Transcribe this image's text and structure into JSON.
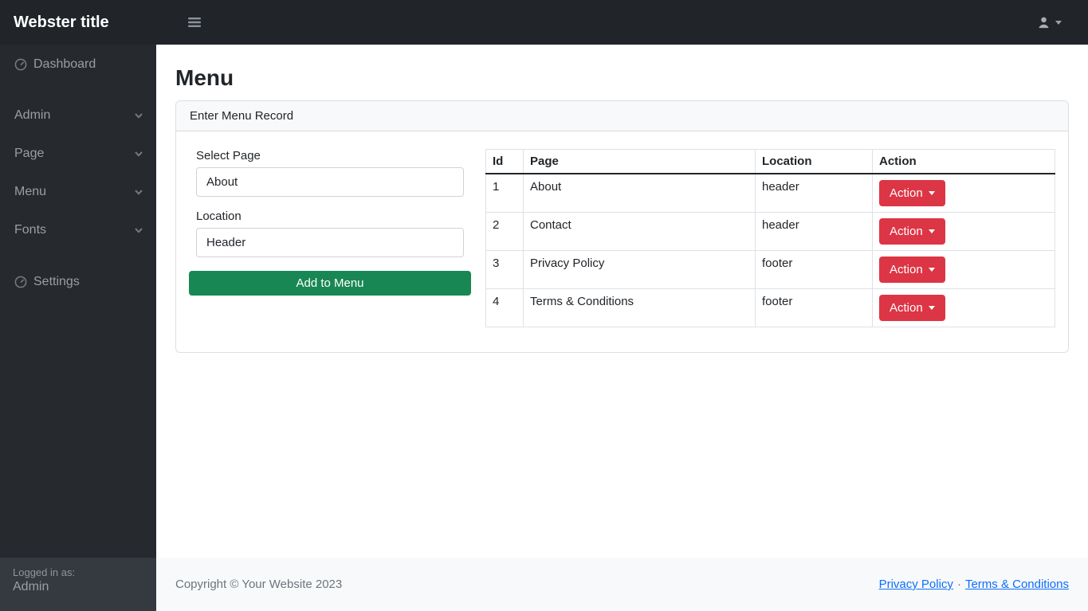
{
  "navbar": {
    "brand": "Webster title"
  },
  "sidebar": {
    "items": [
      {
        "label": "Dashboard",
        "icon": "gauge-icon",
        "type": "link"
      },
      {
        "label": "Admin",
        "icon": "chevron-down-icon",
        "type": "collapse"
      },
      {
        "label": "Page",
        "icon": "chevron-down-icon",
        "type": "collapse"
      },
      {
        "label": "Menu",
        "icon": "chevron-down-icon",
        "type": "collapse"
      },
      {
        "label": "Fonts",
        "icon": "chevron-down-icon",
        "type": "collapse"
      },
      {
        "label": "Settings",
        "icon": "gauge-icon",
        "type": "link"
      }
    ],
    "footer": {
      "label": "Logged in as:",
      "user": "Admin"
    }
  },
  "page": {
    "title": "Menu"
  },
  "card": {
    "header": "Enter Menu Record",
    "form": {
      "select_page_label": "Select Page",
      "select_page_value": "About",
      "location_label": "Location",
      "location_value": "Header",
      "submit_label": "Add to Menu"
    },
    "table": {
      "columns": [
        "Id",
        "Page",
        "Location",
        "Action"
      ],
      "rows": [
        {
          "id": "1",
          "page": "About",
          "location": "header",
          "action": "Action"
        },
        {
          "id": "2",
          "page": "Contact",
          "location": "header",
          "action": "Action"
        },
        {
          "id": "3",
          "page": "Privacy Policy",
          "location": "footer",
          "action": "Action"
        },
        {
          "id": "4",
          "page": "Terms & Conditions",
          "location": "footer",
          "action": "Action"
        }
      ]
    }
  },
  "footer": {
    "copyright": "Copyright © Your Website 2023",
    "links": [
      "Privacy Policy",
      "Terms & Conditions"
    ],
    "separator": "·"
  },
  "colors": {
    "accent-green": "#198754",
    "accent-red": "#dc3545",
    "link-blue": "#0d6efd",
    "navbar-bg": "#212529",
    "sidebar-footer-bg": "#343a40"
  }
}
